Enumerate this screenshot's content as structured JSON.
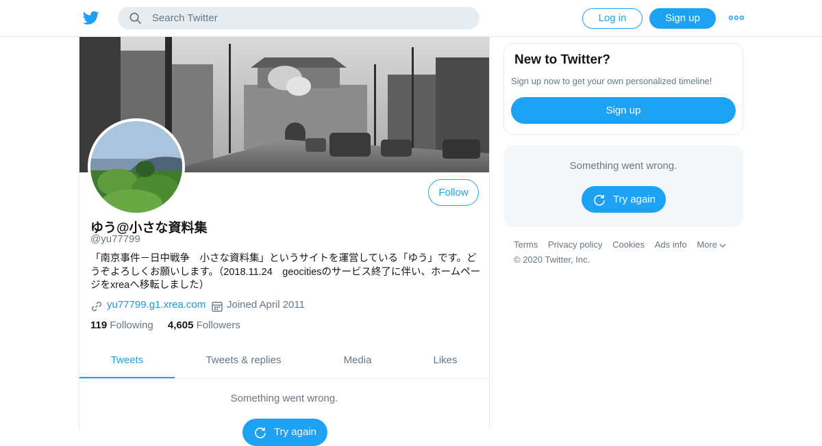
{
  "header": {
    "search_placeholder": "Search Twitter",
    "login_label": "Log in",
    "signup_label": "Sign up",
    "brand_color": "#1da1f2"
  },
  "profile": {
    "display_name": "ゆう@小さな資料集",
    "handle": "@yu77799",
    "bio": "「南京事件－日中戦争　小さな資料集」というサイトを運営している「ゆう」です。どうぞよろしくお願いします。（2018.11.24　geocitiesのサービス終了に伴い、ホームページをxreaへ移転しました）",
    "website": "yu77799.g1.xrea.com",
    "joined": "Joined April 2011",
    "following_count": "119",
    "following_label": "Following",
    "followers_count": "4,605",
    "followers_label": "Followers",
    "follow_label": "Follow"
  },
  "tabs": [
    {
      "label": "Tweets",
      "active": true
    },
    {
      "label": "Tweets & replies",
      "active": false
    },
    {
      "label": "Media",
      "active": false
    },
    {
      "label": "Likes",
      "active": false
    }
  ],
  "timeline": {
    "error_message": "Something went wrong.",
    "retry_label": "Try again"
  },
  "sidebar": {
    "new_title": "New to Twitter?",
    "new_subtitle": "Sign up now to get your own personalized timeline!",
    "signup_label": "Sign up",
    "error_message": "Something went wrong.",
    "retry_label": "Try again"
  },
  "footer": {
    "links": [
      "Terms",
      "Privacy policy",
      "Cookies",
      "Ads info",
      "More"
    ],
    "copyright": "© 2020 Twitter, Inc."
  }
}
